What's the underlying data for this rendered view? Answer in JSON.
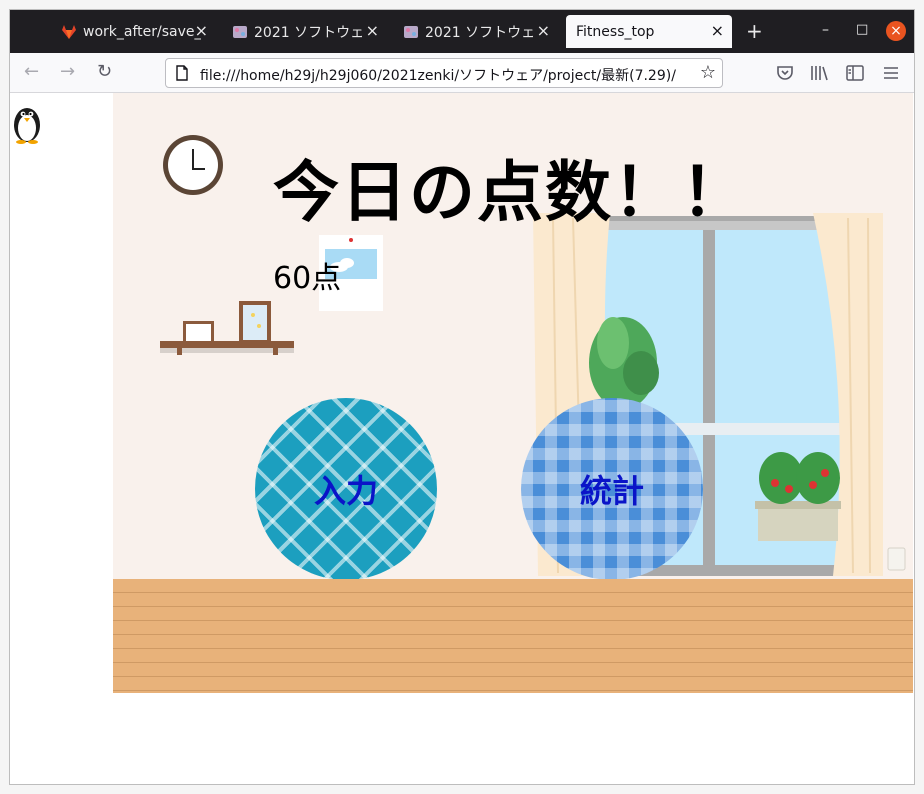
{
  "browser": {
    "tabs": [
      {
        "title": "work_after/save_",
        "icon": "gitlab-icon",
        "active": false
      },
      {
        "title": "2021 ソフトウェ",
        "icon": "page-favicon-icon",
        "active": false
      },
      {
        "title": "2021 ソフトウェ",
        "icon": "page-favicon-icon",
        "active": false
      },
      {
        "title": "Fitness_top",
        "icon": "",
        "active": true
      }
    ],
    "new_tab": "+",
    "close_glyph": "×",
    "url": "file:///home/h29j/h29j060/2021zenki/ソフトウェア/project/最新(7.29)/",
    "window_buttons": {
      "minimize": "–",
      "maximize": "□",
      "close": "×"
    }
  },
  "page": {
    "heading": "今日の点数！！",
    "score": "60点",
    "buttons": {
      "input": "入力",
      "stats": "統計"
    }
  },
  "colors": {
    "accent_close": "#e95420",
    "button_text": "#0a14c8",
    "wall": "#f9f1ec",
    "floor": "#e8b27a"
  }
}
